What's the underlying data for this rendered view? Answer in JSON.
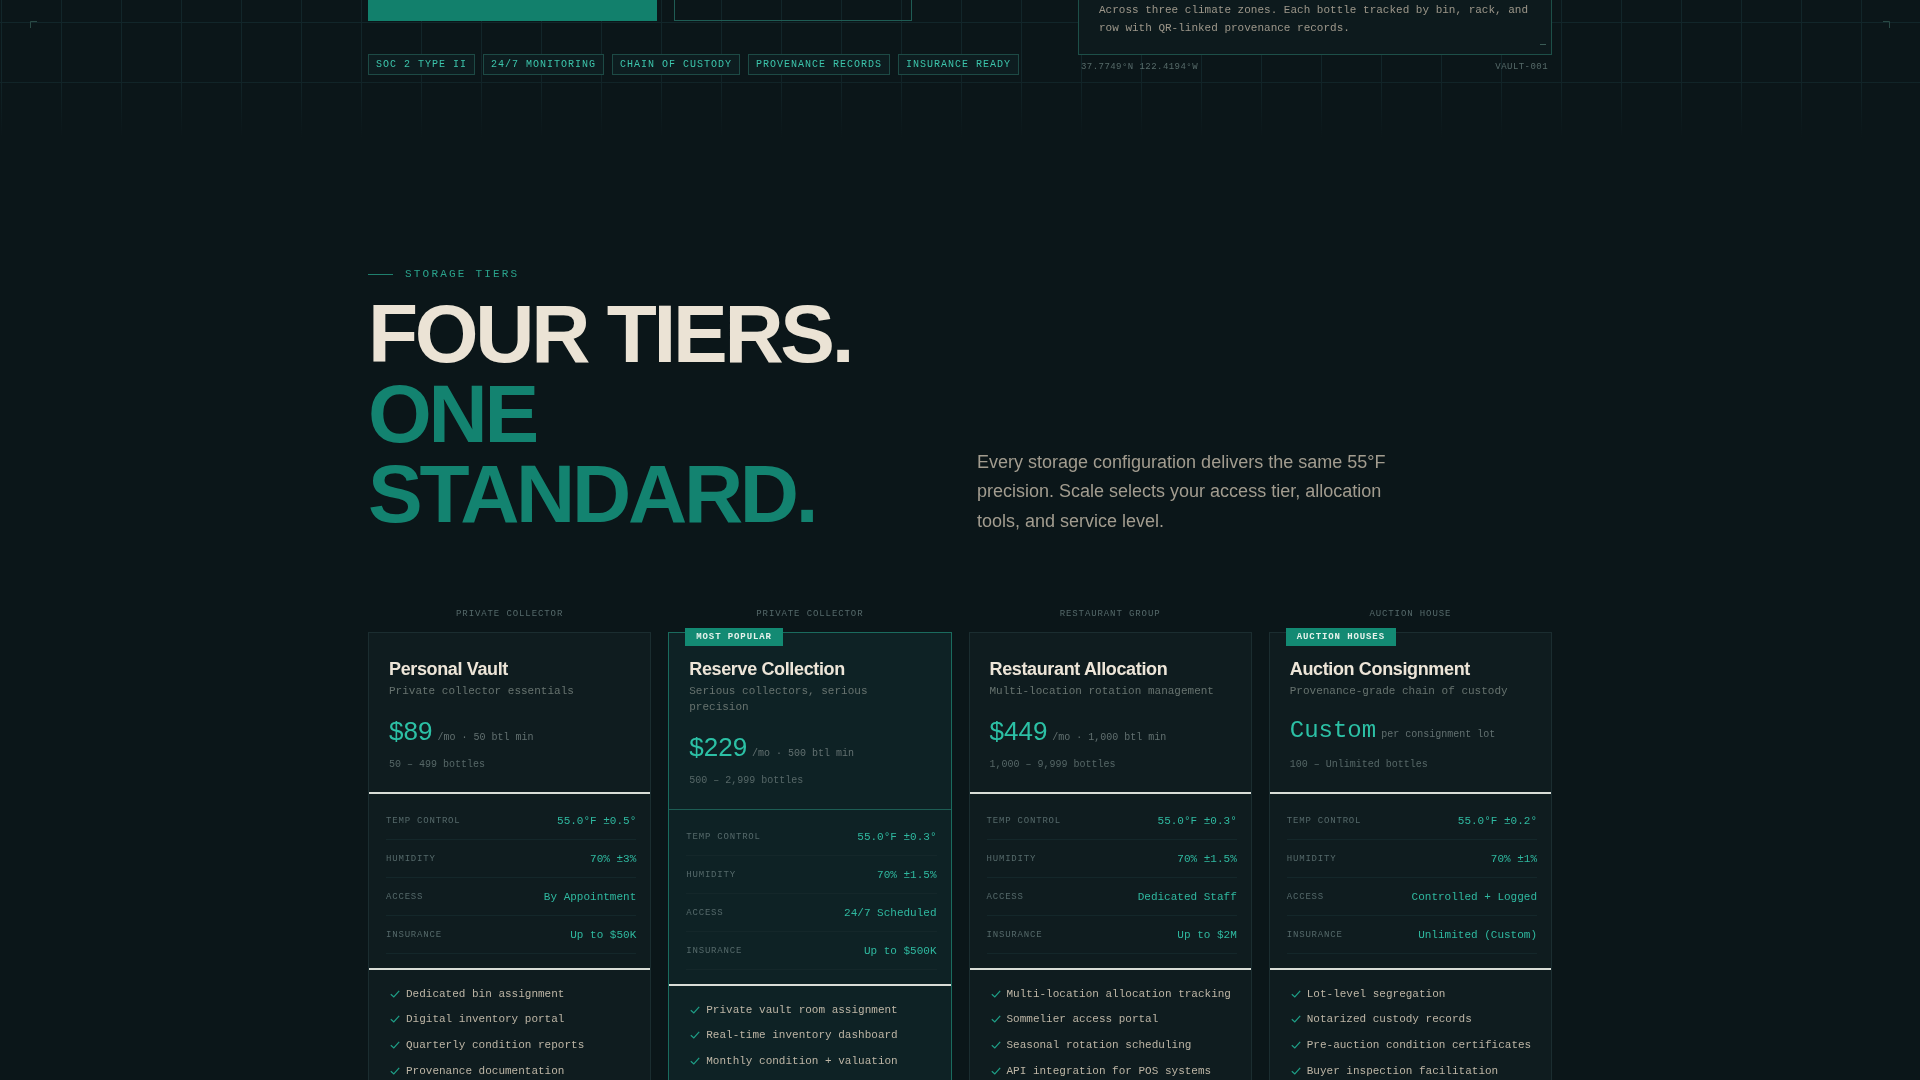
{
  "hero": {
    "buttons": [
      {
        "kind": "primary"
      },
      {
        "kind": "outline"
      }
    ],
    "badges": [
      "SOC 2 TYPE II",
      "24/7 MONITORING",
      "CHAIN OF CUSTODY",
      "PROVENANCE RECORDS",
      "INSURANCE READY"
    ],
    "panel": {
      "text": "Across three climate zones. Each bottle tracked by bin, rack, and row with QR-linked provenance records.",
      "coordinates": "37.7749°N 122.4194°W",
      "code": "VAULT-001"
    }
  },
  "section": {
    "eyebrow": "STORAGE TIERS",
    "heading": [
      {
        "text": "FOUR TIERS.",
        "accent": false
      },
      {
        "text": "ONE",
        "accent": true
      },
      {
        "text": "STANDARD.",
        "accent": true
      }
    ],
    "description": "Every storage configuration delivers the same 55°F precision. Scale selects your access tier, allocation tools, and service level."
  },
  "tiers": [
    {
      "segment": "PRIVATE COLLECTOR",
      "highlighted": false,
      "name": "Personal Vault",
      "description": "Private collector essentials",
      "price": {
        "kind": "fixed",
        "value": "$89",
        "unit": "/mo · 50 btl min"
      },
      "range": "50 – 499 bottles",
      "specs": [
        {
          "label": "TEMP CONTROL",
          "value": "55.0°F ±0.5°"
        },
        {
          "label": "HUMIDITY",
          "value": "70% ±3%"
        },
        {
          "label": "ACCESS",
          "value": "By Appointment"
        },
        {
          "label": "INSURANCE",
          "value": "Up to $50K"
        }
      ],
      "features": [
        "Dedicated bin assignment",
        "Digital inventory portal",
        "Quarterly condition reports",
        "Provenance documentation"
      ]
    },
    {
      "segment": "PRIVATE COLLECTOR",
      "badge": "MOST POPULAR",
      "highlighted": true,
      "name": "Reserve Collection",
      "description": "Serious collectors, serious precision",
      "price": {
        "kind": "fixed",
        "value": "$229",
        "unit": "/mo · 500 btl min"
      },
      "range": "500 – 2,999 bottles",
      "specs": [
        {
          "label": "TEMP CONTROL",
          "value": "55.0°F ±0.3°"
        },
        {
          "label": "HUMIDITY",
          "value": "70% ±1.5%"
        },
        {
          "label": "ACCESS",
          "value": "24/7 Scheduled"
        },
        {
          "label": "INSURANCE",
          "value": "Up to $500K"
        }
      ],
      "features": [
        "Private vault room assignment",
        "Real-time inventory dashboard",
        "Monthly condition + valuation"
      ]
    },
    {
      "segment": "RESTAURANT GROUP",
      "highlighted": false,
      "name": "Restaurant Allocation",
      "description": "Multi-location rotation management",
      "price": {
        "kind": "fixed",
        "value": "$449",
        "unit": "/mo · 1,000 btl min"
      },
      "range": "1,000 – 9,999 bottles",
      "specs": [
        {
          "label": "TEMP CONTROL",
          "value": "55.0°F ±0.3°"
        },
        {
          "label": "HUMIDITY",
          "value": "70% ±1.5%"
        },
        {
          "label": "ACCESS",
          "value": "Dedicated Staff"
        },
        {
          "label": "INSURANCE",
          "value": "Up to $2M"
        }
      ],
      "features": [
        "Multi-location allocation tracking",
        "Sommelier access portal",
        "Seasonal rotation scheduling",
        "API integration for POS systems"
      ]
    },
    {
      "segment": "AUCTION HOUSE",
      "badge": "AUCTION HOUSES",
      "highlighted": false,
      "name": "Auction Consignment",
      "description": "Provenance-grade chain of custody",
      "price": {
        "kind": "quote",
        "value": "Custom",
        "unit": "per consignment lot"
      },
      "range": "100 – Unlimited bottles",
      "specs": [
        {
          "label": "TEMP CONTROL",
          "value": "55.0°F ±0.2°"
        },
        {
          "label": "HUMIDITY",
          "value": "70% ±1%"
        },
        {
          "label": "ACCESS",
          "value": "Controlled + Logged"
        },
        {
          "label": "INSURANCE",
          "value": "Unlimited (Custom)"
        }
      ],
      "features": [
        "Lot-level segregation",
        "Notarized custody records",
        "Pre-auction condition certificates",
        "Buyer inspection facilitation"
      ]
    }
  ]
}
